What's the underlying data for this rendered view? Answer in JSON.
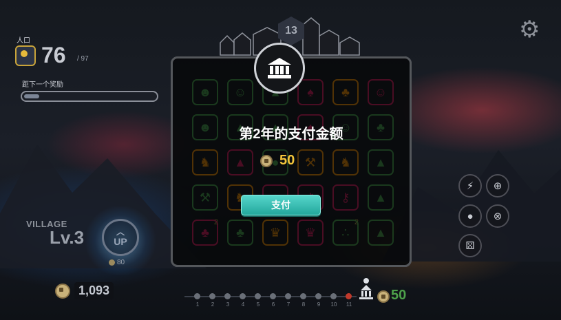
{
  "hud": {
    "population_label": "人口",
    "population_value": "76",
    "population_max": "/ 97",
    "next_reward_label": "距下一个奖励",
    "next_reward_progress": 0.12
  },
  "top": {
    "day_number": "13"
  },
  "modal": {
    "title": "第2年的支付金额",
    "amount": "50",
    "pay_button": "支付"
  },
  "board_tiles": [
    {
      "color": "#4caf50",
      "icon": "☻",
      "num": ""
    },
    {
      "color": "#4caf50",
      "icon": "☺",
      "num": ""
    },
    {
      "color": "#4caf50",
      "icon": "▲",
      "num": ""
    },
    {
      "color": "#e91e63",
      "icon": "♠",
      "num": ""
    },
    {
      "color": "#ff9800",
      "icon": "♣",
      "num": ""
    },
    {
      "color": "#e91e63",
      "icon": "☺",
      "num": ""
    },
    {
      "color": "#4caf50",
      "icon": "☻",
      "num": ""
    },
    {
      "color": "#4caf50",
      "icon": "▲",
      "num": ""
    },
    {
      "color": "#4caf50",
      "icon": "▲",
      "num": ""
    },
    {
      "color": "#e91e63",
      "icon": "♠",
      "num": ""
    },
    {
      "color": "#4caf50",
      "icon": "☺",
      "num": ""
    },
    {
      "color": "#4caf50",
      "icon": "♣",
      "num": ""
    },
    {
      "color": "#ff9800",
      "icon": "♞",
      "num": ""
    },
    {
      "color": "#e91e63",
      "icon": "▲",
      "num": ""
    },
    {
      "color": "#4caf50",
      "icon": "●",
      "num": ""
    },
    {
      "color": "#ff9800",
      "icon": "⚒",
      "num": ""
    },
    {
      "color": "#ff9800",
      "icon": "♞",
      "num": ""
    },
    {
      "color": "#4caf50",
      "icon": "▲",
      "num": ""
    },
    {
      "color": "#4caf50",
      "icon": "⚒",
      "num": ""
    },
    {
      "color": "#ff9800",
      "icon": "♞",
      "num": ""
    },
    {
      "color": "#e91e63",
      "icon": "♠",
      "num": ""
    },
    {
      "color": "#e91e63",
      "icon": "⚷",
      "num": ""
    },
    {
      "color": "#e91e63",
      "icon": "⚷",
      "num": ""
    },
    {
      "color": "#4caf50",
      "icon": "▲",
      "num": ""
    },
    {
      "color": "#e91e63",
      "icon": "♣",
      "num": "2"
    },
    {
      "color": "#4caf50",
      "icon": "♣",
      "num": ""
    },
    {
      "color": "#ff9800",
      "icon": "♛",
      "num": ""
    },
    {
      "color": "#e91e63",
      "icon": "♛",
      "num": ""
    },
    {
      "color": "#4caf50",
      "icon": "∴",
      "num": "2"
    },
    {
      "color": "#4caf50",
      "icon": "▲",
      "num": ""
    }
  ],
  "village": {
    "label": "VILLAGE",
    "level": "Lv.3",
    "up_label": "UP",
    "up_cost": "80"
  },
  "money": {
    "value": "1,093"
  },
  "timeline": {
    "ticks": [
      "1",
      "2",
      "3",
      "4",
      "5",
      "6",
      "7",
      "8",
      "9",
      "10",
      "11"
    ],
    "current_index": 10,
    "next_payment": "50"
  },
  "right_buttons": [
    {
      "name": "bolt-icon",
      "glyph": "⚡"
    },
    {
      "name": "crosshair-icon",
      "glyph": "⊕"
    },
    {
      "name": "apple-icon",
      "glyph": "●"
    },
    {
      "name": "target-icon",
      "glyph": "⊗"
    },
    {
      "name": "dice-icon",
      "glyph": "⚄"
    }
  ]
}
